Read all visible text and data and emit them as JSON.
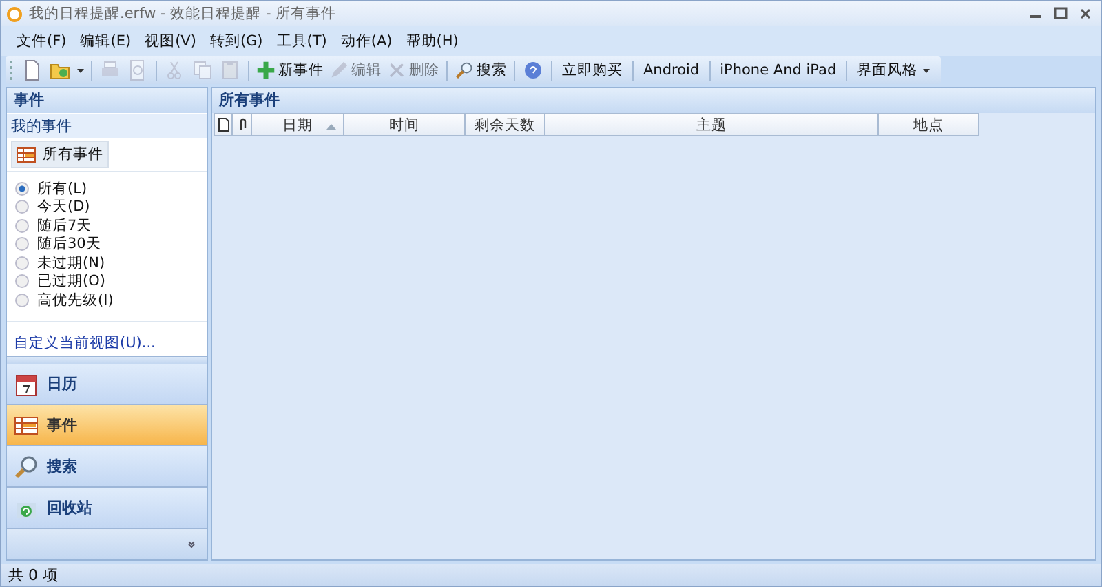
{
  "window": {
    "title": "我的日程提醒.erfw - 效能日程提醒 - 所有事件"
  },
  "menu": [
    {
      "label": "文件(F)"
    },
    {
      "label": "编辑(E)"
    },
    {
      "label": "视图(V)"
    },
    {
      "label": "转到(G)"
    },
    {
      "label": "工具(T)"
    },
    {
      "label": "动作(A)"
    },
    {
      "label": "帮助(H)"
    }
  ],
  "toolbar": [
    {
      "kind": "icon",
      "disabled": false
    },
    {
      "kind": "icon-menu",
      "disabled": false
    },
    {
      "kind": "separator"
    },
    {
      "kind": "icon",
      "disabled": true
    },
    {
      "kind": "icon",
      "disabled": true
    },
    {
      "kind": "separator"
    },
    {
      "kind": "icon",
      "disabled": true
    },
    {
      "kind": "icon",
      "disabled": true
    },
    {
      "kind": "icon",
      "disabled": true
    },
    {
      "kind": "separator"
    },
    {
      "kind": "button",
      "label": "新事件",
      "disabled": false
    },
    {
      "kind": "button",
      "label": "编辑",
      "disabled": true
    },
    {
      "kind": "button",
      "label": "删除",
      "disabled": true
    },
    {
      "kind": "separator"
    },
    {
      "kind": "button",
      "label": "搜索",
      "disabled": false
    },
    {
      "kind": "separator"
    },
    {
      "kind": "icon",
      "disabled": false
    },
    {
      "kind": "separator"
    },
    {
      "kind": "text",
      "label": "立即购买"
    },
    {
      "kind": "separator"
    },
    {
      "kind": "text",
      "label": "Android"
    },
    {
      "kind": "separator"
    },
    {
      "kind": "text",
      "label": "iPhone And iPad"
    },
    {
      "kind": "separator"
    },
    {
      "kind": "menu",
      "label": "界面风格"
    }
  ],
  "sidebar": {
    "header": "事件",
    "section": "我的事件",
    "view": {
      "label": "所有事件",
      "selected": true
    },
    "filters": [
      {
        "label": "所有(L)",
        "selected": true
      },
      {
        "label": "今天(D)",
        "selected": false
      },
      {
        "label": "随后7天",
        "selected": false
      },
      {
        "label": "随后30天",
        "selected": false
      },
      {
        "label": "未过期(N)",
        "selected": false
      },
      {
        "label": "已过期(O)",
        "selected": false
      },
      {
        "label": "高优先级(I)",
        "selected": false
      }
    ],
    "customize_link": "自定义当前视图(U)...",
    "nav": [
      {
        "label": "日历",
        "selected": false
      },
      {
        "label": "事件",
        "selected": true
      },
      {
        "label": "搜索",
        "selected": false
      },
      {
        "label": "回收站",
        "selected": false
      }
    ]
  },
  "content": {
    "title": "所有事件",
    "columns": [
      {
        "kind": "icon"
      },
      {
        "kind": "icon"
      },
      {
        "label": "日期",
        "sorted": true
      },
      {
        "label": "时间",
        "sorted": false
      },
      {
        "label": "剩余天数",
        "sorted": false
      },
      {
        "label": "主题",
        "sorted": false
      },
      {
        "label": "地点",
        "sorted": false
      }
    ]
  },
  "status_bar": {
    "text": "共 0 项"
  }
}
